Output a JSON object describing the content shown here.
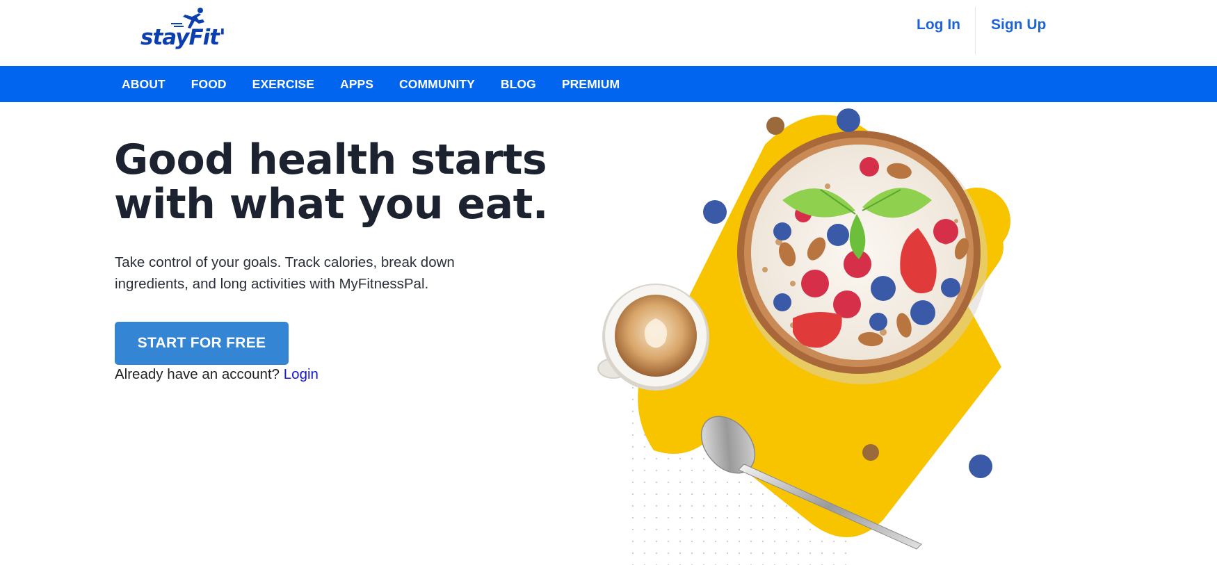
{
  "brand": {
    "logo_text": "stayFit'",
    "accent": "#0165f0",
    "logo_color": "#0b3fb0"
  },
  "header": {
    "login_label": "Log In",
    "signup_label": "Sign Up"
  },
  "nav": {
    "items": [
      "ABOUT",
      "FOOD",
      "EXERCISE",
      "APPS",
      "COMMUNITY",
      "BLOG",
      "PREMIUM"
    ]
  },
  "hero": {
    "title_line1": "Good health starts",
    "title_line2": "with what you eat.",
    "subtitle": "Take control of your goals. Track calories, break down ingredients, and long activities with MyFitnessPal.",
    "cta_label": "START FOR FREE",
    "cta_color": "#3485d3",
    "account_prompt": "Already have an account?",
    "account_link": "Login"
  },
  "illustration": {
    "name": "breakfast-bowl-with-coffee",
    "yellow": "#f8c400"
  }
}
